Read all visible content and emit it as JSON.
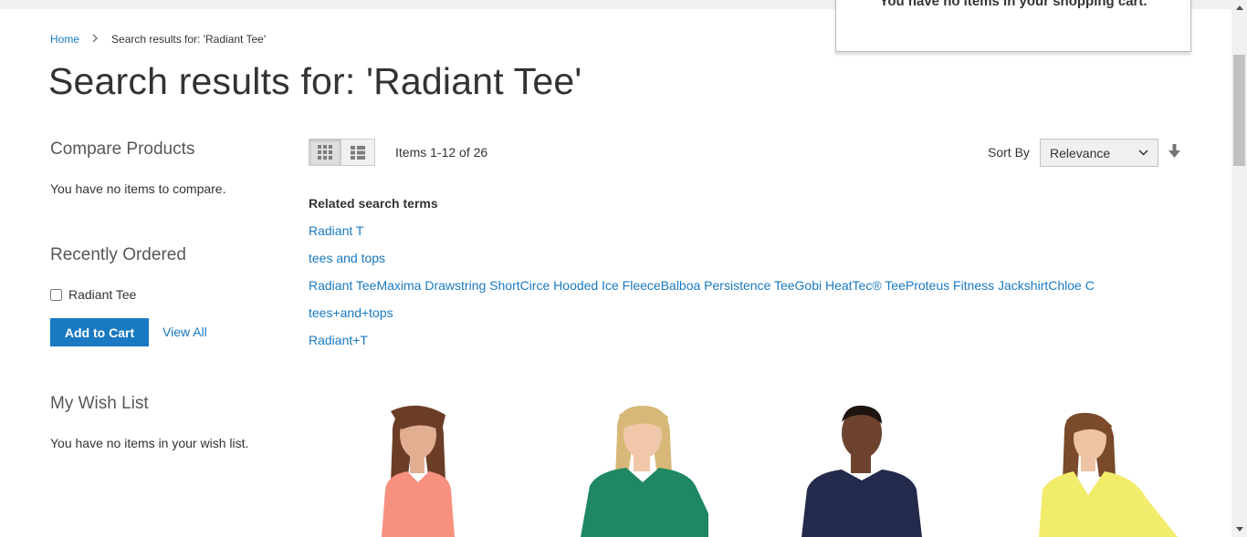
{
  "minicart": {
    "message": "You have no items in your shopping cart."
  },
  "breadcrumb": {
    "home": "Home",
    "current": "Search results for: 'Radiant Tee'"
  },
  "page_title": "Search results for: 'Radiant Tee'",
  "sidebar": {
    "compare": {
      "title": "Compare Products",
      "empty": "You have no items to compare."
    },
    "recently_ordered": {
      "title": "Recently Ordered",
      "item": "Radiant Tee",
      "add_to_cart": "Add to Cart",
      "view_all": "View All"
    },
    "wishlist": {
      "title": "My Wish List",
      "empty": "You have no items in your wish list."
    }
  },
  "toolbar": {
    "amount": "Items 1-12 of 26",
    "sort_label": "Sort By",
    "sort_value": "Relevance"
  },
  "related": {
    "title": "Related search terms",
    "terms": [
      "Radiant T",
      "tees and tops",
      "Radiant TeeMaxima Drawstring ShortCirce Hooded Ice FleeceBalboa Persistence TeeGobi HeatTec® TeeProteus Fitness JackshirtChloe C",
      "tees+and+tops",
      "Radiant+T"
    ]
  },
  "colors": {
    "link": "#1979c3",
    "button": "#1979c3"
  },
  "products": [
    {
      "shirt": "#f7907f",
      "skin": "#e2ae92",
      "hair": "#6b3d26"
    },
    {
      "shirt": "#1f8763",
      "skin": "#f0c7a8",
      "hair": "#d8b878"
    },
    {
      "shirt": "#232a4b",
      "skin": "#6d4330",
      "hair": "#1e1410"
    },
    {
      "shirt": "#f2ec6b",
      "skin": "#eec3a3",
      "hair": "#7a4a2a"
    }
  ]
}
